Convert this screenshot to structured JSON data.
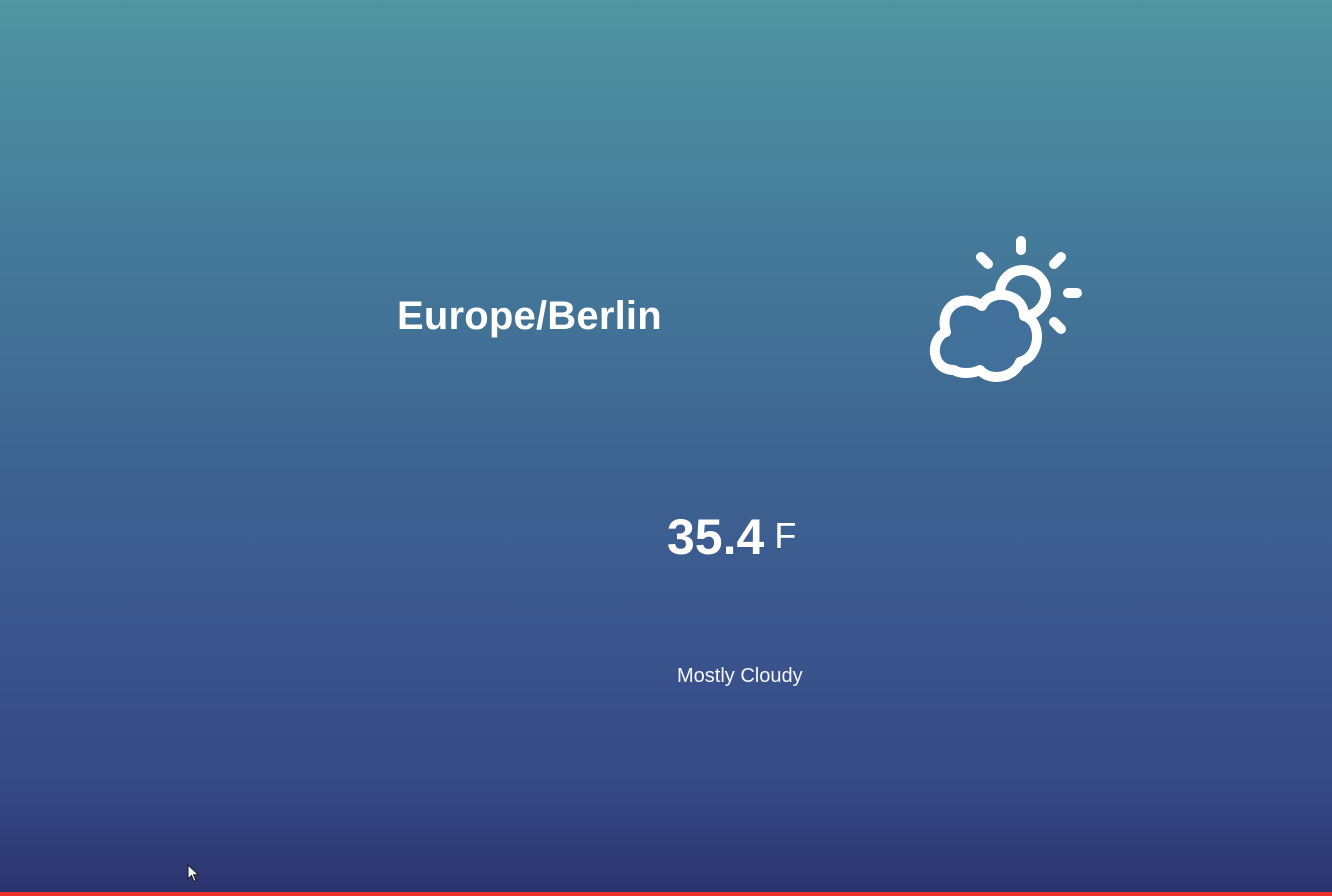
{
  "weather": {
    "location": "Europe/Berlin",
    "temperature": "35.4",
    "unit": "F",
    "summary": "Mostly Cloudy",
    "icon": "partly-cloudy-day-icon"
  },
  "colors": {
    "gradient_top": "#5095a2",
    "gradient_bottom": "#2b336c",
    "text": "#ffffff",
    "bottom_bar": "#e8322a"
  }
}
